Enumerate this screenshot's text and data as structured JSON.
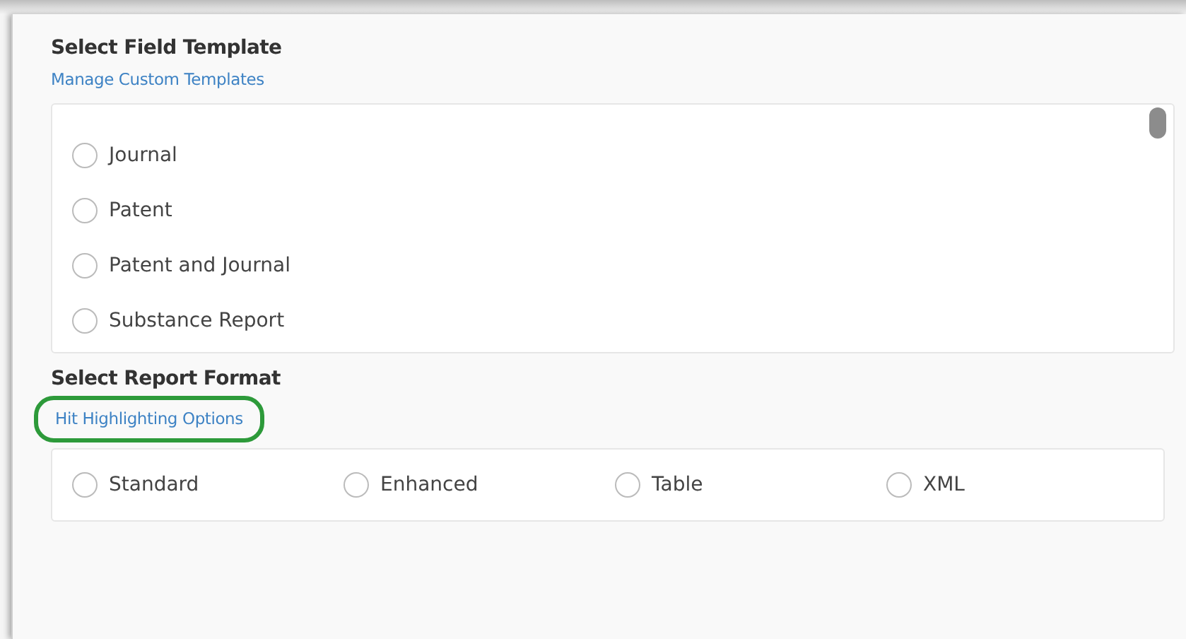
{
  "field_template": {
    "title": "Select Field Template",
    "link": "Manage Custom Templates",
    "options": [
      {
        "label": "Journal",
        "selected": false
      },
      {
        "label": "Patent",
        "selected": false
      },
      {
        "label": "Patent and Journal",
        "selected": false
      },
      {
        "label": "Substance Report",
        "selected": false
      }
    ]
  },
  "report_format": {
    "title": "Select Report Format",
    "link": "Hit Highlighting Options",
    "link_highlighted": true,
    "options": [
      {
        "label": "Standard",
        "selected": false
      },
      {
        "label": "Enhanced",
        "selected": false
      },
      {
        "label": "Table",
        "selected": false
      },
      {
        "label": "XML",
        "selected": false
      }
    ]
  }
}
